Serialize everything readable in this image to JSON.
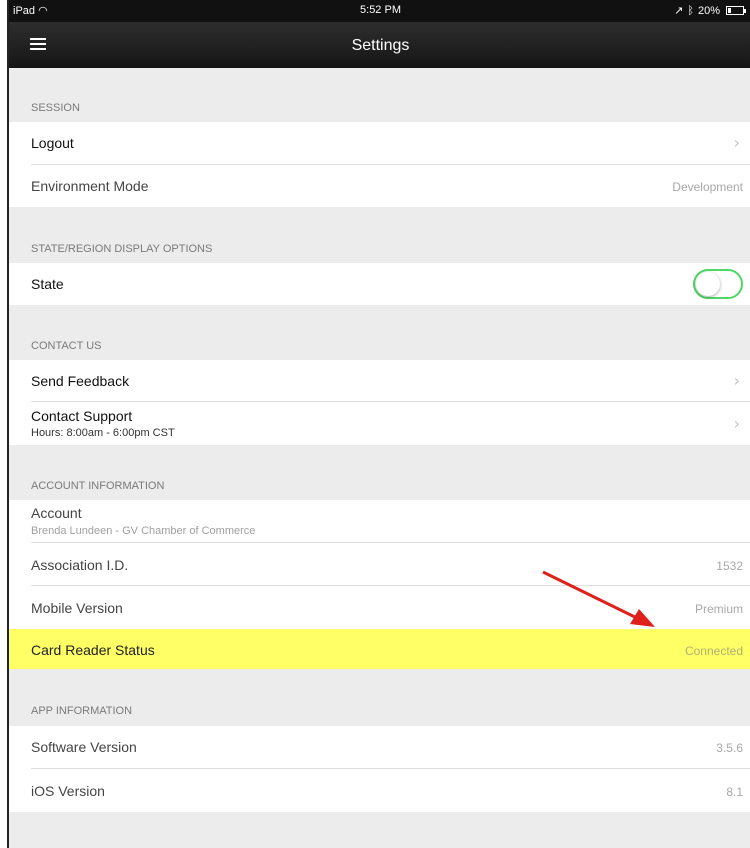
{
  "status_bar": {
    "device": "iPad",
    "time": "5:52 PM",
    "battery": "20%",
    "battery_level": 0.2
  },
  "nav": {
    "title": "Settings",
    "menu_icon": "hamburger-menu-icon"
  },
  "sections": {
    "session": {
      "header": "SESSION",
      "logout": {
        "label": "Logout"
      },
      "environment": {
        "label": "Environment Mode",
        "value": "Development"
      }
    },
    "display": {
      "header": "STATE/REGION DISPLAY OPTIONS",
      "state": {
        "label": "State",
        "toggle_on": false
      }
    },
    "contact": {
      "header": "CONTACT US",
      "feedback": {
        "label": "Send Feedback"
      },
      "support": {
        "label": "Contact Support",
        "sub": "Hours: 8:00am - 6:00pm CST"
      }
    },
    "account": {
      "header": "ACCOUNT INFORMATION",
      "account": {
        "label": "Account",
        "sub": "Brenda Lundeen - GV Chamber of Commerce"
      },
      "association": {
        "label": "Association I.D.",
        "value": "1532"
      },
      "mobile": {
        "label": "Mobile Version",
        "value": "Premium"
      },
      "card_reader": {
        "label": "Card Reader Status",
        "value": "Connected"
      }
    },
    "app": {
      "header": "APP INFORMATION",
      "software": {
        "label": "Software Version",
        "value": "3.5.6"
      },
      "ios": {
        "label": "iOS Version",
        "value": "8.1"
      }
    }
  },
  "colors": {
    "toggle_border": "#4cd964",
    "highlight": "#ffff66",
    "annotation_arrow": "#e0201a"
  }
}
